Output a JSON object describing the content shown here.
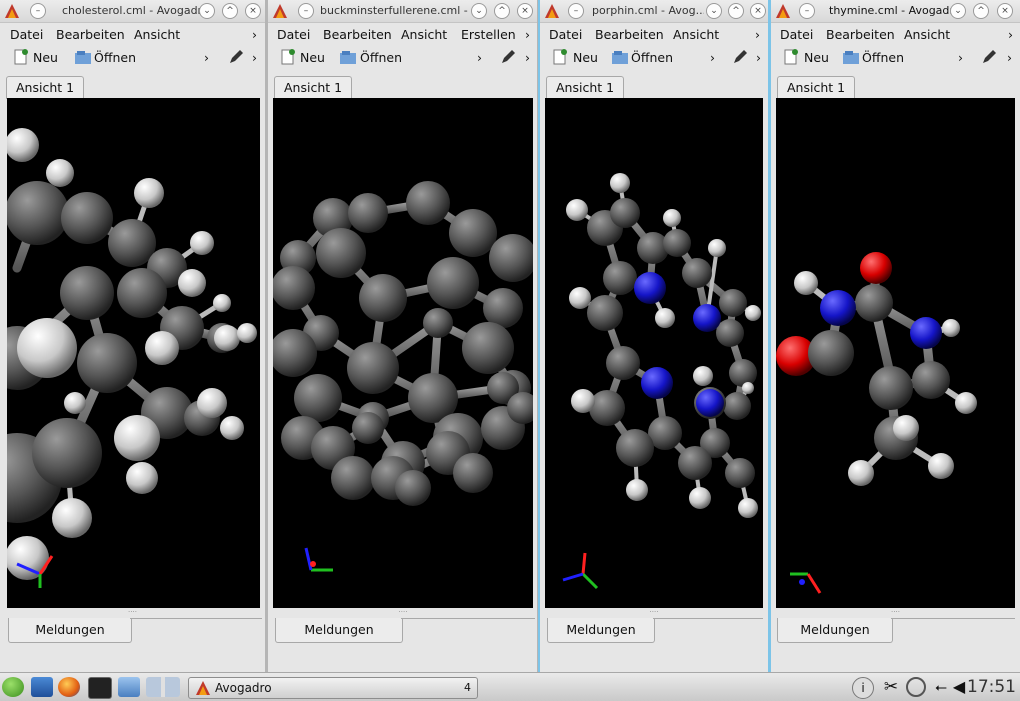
{
  "windows": [
    {
      "title": "cholesterol.cml - Avogadro",
      "menus": [
        "Datei",
        "Bearbeiten",
        "Ansicht"
      ],
      "toolbar": {
        "new": "Neu",
        "open": "Öffnen"
      },
      "tab": "Ansicht 1",
      "messages_tab": "Meldungen"
    },
    {
      "title": "buckminsterfullerene.cml - ...",
      "menus": [
        "Datei",
        "Bearbeiten",
        "Ansicht",
        "Erstellen"
      ],
      "toolbar": {
        "new": "Neu",
        "open": "Öffnen"
      },
      "tab": "Ansicht 1",
      "messages_tab": "Meldungen"
    },
    {
      "title": "porphin.cml - Avog...",
      "menus": [
        "Datei",
        "Bearbeiten",
        "Ansicht"
      ],
      "toolbar": {
        "new": "Neu",
        "open": "Öffnen"
      },
      "tab": "Ansicht 1",
      "messages_tab": "Meldungen"
    },
    {
      "title": "thymine.cml - Avogadro",
      "menus": [
        "Datei",
        "Bearbeiten",
        "Ansicht"
      ],
      "toolbar": {
        "new": "Neu",
        "open": "Öffnen"
      },
      "tab": "Ansicht 1",
      "messages_tab": "Meldungen"
    }
  ],
  "colors": {
    "accent": "#7cc4e8",
    "carbon": "#7a7a7a",
    "hydrogen": "#e8e8e8",
    "nitrogen": "#2a2ad8",
    "oxygen": "#e01010"
  },
  "icons": [
    "avogadro-icon",
    "minimize-icon",
    "maximize-icon",
    "close-icon",
    "new-file-icon",
    "open-folder-icon",
    "edit-pencil-icon"
  ],
  "taskbar": {
    "task_label": "Avogadro",
    "task_count": "4",
    "clock": "17:51"
  }
}
